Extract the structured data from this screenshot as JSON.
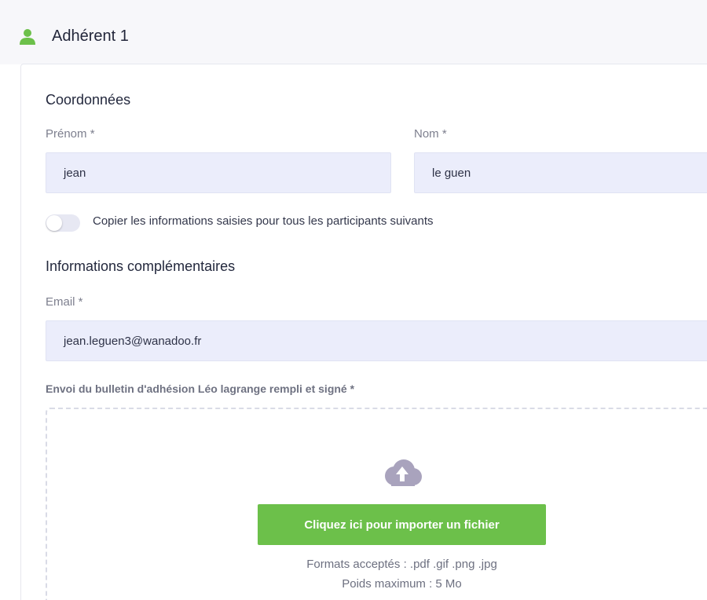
{
  "header": {
    "title": "Adhérent 1",
    "icon": "person-icon",
    "accent": "#6cc04a"
  },
  "coordonnees": {
    "title": "Coordonnées",
    "firstname_label": "Prénom *",
    "firstname_value": "jean",
    "lastname_label": "Nom *",
    "lastname_value": "le guen"
  },
  "copy_toggle": {
    "label": "Copier les informations saisies pour tous les participants suivants",
    "checked": false
  },
  "complementaires": {
    "title": "Informations complémentaires",
    "email_label": "Email *",
    "email_value": "jean.leguen3@wanadoo.fr",
    "upload_label": "Envoi du bulletin d'adhésion Léo lagrange rempli et signé *"
  },
  "upload": {
    "icon": "cloud-upload-icon",
    "button_label": "Cliquez ici pour importer un fichier",
    "formats": "Formats acceptés : .pdf .gif .png .jpg",
    "max_size": "Poids maximum : 5 Mo",
    "button_color": "#6cc04a"
  }
}
